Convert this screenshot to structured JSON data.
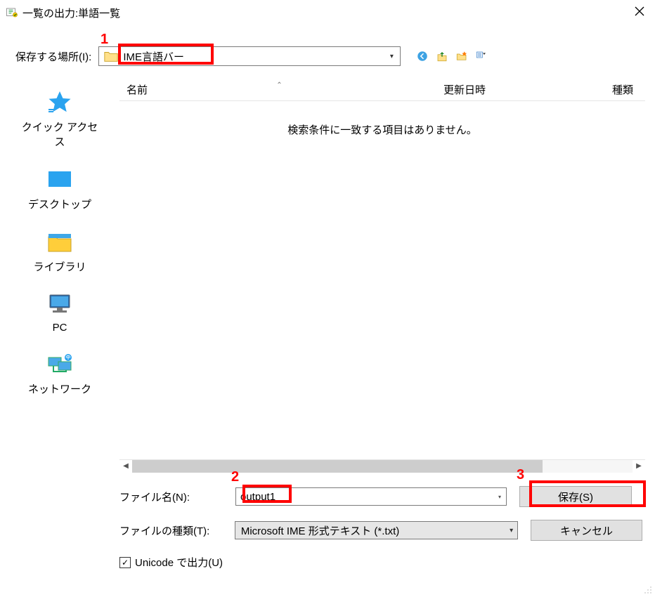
{
  "window": {
    "title": "一覧の出力:単語一覧"
  },
  "saveIn": {
    "label": "保存する場所(I):",
    "folderName": "IME言語バー"
  },
  "places": {
    "quickAccess": "クイック アクセス",
    "desktop": "デスクトップ",
    "libraries": "ライブラリ",
    "pc": "PC",
    "network": "ネットワーク"
  },
  "listHeader": {
    "name": "名前",
    "date": "更新日時",
    "type": "種類"
  },
  "noItems": "検索条件に一致する項目はありません。",
  "form": {
    "filenameLabel": "ファイル名(N):",
    "filenameValue": "output1",
    "filetypeLabel": "ファイルの種類(T):",
    "filetypeValue": "Microsoft IME 形式テキスト (*.txt)",
    "saveButton": "保存(S)",
    "cancelButton": "キャンセル"
  },
  "unicode": {
    "label": "Unicode で出力(U)",
    "checked": true
  },
  "annotations": {
    "one": "1",
    "two": "2",
    "three": "3"
  }
}
